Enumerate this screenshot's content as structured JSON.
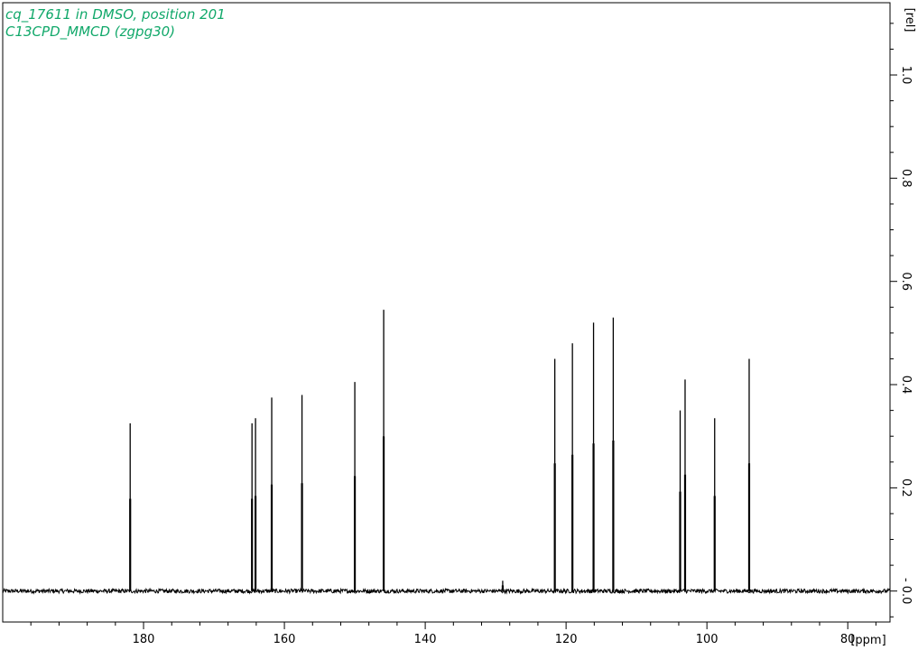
{
  "chart_data": {
    "type": "line",
    "title_lines": [
      "cq_17611 in DMSO, position 201",
      "C13CPD_MMCD (zgpg30)"
    ],
    "title_color": "#11a86a",
    "xlabel": "[ppm]",
    "ylabel": "[rel]",
    "x_reversed": true,
    "xlim": [
      200,
      74
    ],
    "ylim": [
      -0.06,
      1.14
    ],
    "x_ticks": [
      180,
      160,
      140,
      120,
      100,
      80
    ],
    "x_tick_labels": [
      "180",
      "160",
      "140",
      "120",
      "100",
      "80"
    ],
    "y_ticks": [
      0.0,
      0.2,
      0.4,
      0.6,
      0.8,
      1.0
    ],
    "y_tick_labels": [
      "- 0.0",
      "0.2",
      "0.4",
      "0.6",
      "0.8",
      "1.0"
    ],
    "grid": false,
    "series": [
      {
        "line_color": "#000000",
        "baseline": 0.0,
        "peaks": [
          {
            "ppm": 181.9,
            "height": 0.325
          },
          {
            "ppm": 164.6,
            "height": 0.325
          },
          {
            "ppm": 164.1,
            "height": 0.335
          },
          {
            "ppm": 161.8,
            "height": 0.375
          },
          {
            "ppm": 157.5,
            "height": 0.38
          },
          {
            "ppm": 150.0,
            "height": 0.405
          },
          {
            "ppm": 145.9,
            "height": 0.545
          },
          {
            "ppm": 129.0,
            "height": 0.02
          },
          {
            "ppm": 121.6,
            "height": 0.45
          },
          {
            "ppm": 119.1,
            "height": 0.48
          },
          {
            "ppm": 116.1,
            "height": 0.52
          },
          {
            "ppm": 113.3,
            "height": 0.53
          },
          {
            "ppm": 103.8,
            "height": 0.35
          },
          {
            "ppm": 103.1,
            "height": 0.41
          },
          {
            "ppm": 98.9,
            "height": 0.335
          },
          {
            "ppm": 94.0,
            "height": 0.45
          }
        ]
      }
    ]
  }
}
